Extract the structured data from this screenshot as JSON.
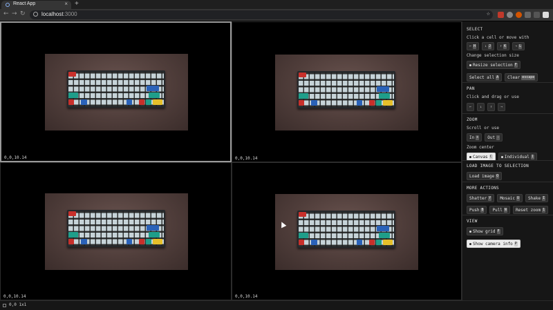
{
  "browser": {
    "tab_title": "React App",
    "tab_close": "×",
    "new_tab": "+",
    "back": "←",
    "forward": "→",
    "reload": "C",
    "url_host": "localhost",
    "url_port": ":3000",
    "star": "☆"
  },
  "grid": {
    "cells": [
      {
        "label": "0,0,10.14"
      },
      {
        "label": "0,0,10.14"
      },
      {
        "label": "0,0,10.14"
      },
      {
        "label": "0,0,10.14"
      }
    ]
  },
  "sidebar": {
    "select": {
      "title": "SELECT",
      "move_text": "Click a cell or move with",
      "move_keys": [
        {
          "icon": "←",
          "key": "H"
        },
        {
          "icon": "↓",
          "key": "J"
        },
        {
          "icon": "↑",
          "key": "K"
        },
        {
          "icon": "→",
          "key": "L"
        }
      ],
      "resize_text": "Change selection size",
      "resize_label": "Resize selection",
      "resize_key": "F",
      "select_all_label": "Select all",
      "select_all_key": "A",
      "clear_label": "Clear",
      "clear_key": "escape"
    },
    "pan": {
      "title": "PAN",
      "text": "Click and drag or use",
      "keys": [
        "←",
        "↓",
        "↑",
        "→"
      ]
    },
    "zoom": {
      "title": "ZOOM",
      "text": "Scroll or use",
      "in_label": "In",
      "in_key": "+",
      "out_label": "Out",
      "out_key": "-",
      "center_text": "Zoom center",
      "canvas_label": "Canvas",
      "canvas_key": "C",
      "individual_label": "Individual",
      "individual_key": "I"
    },
    "load": {
      "title": "LOAD IMAGE TO SELECTION",
      "button_label": "Load image",
      "button_key": "O"
    },
    "more": {
      "title": "MORE ACTIONS",
      "shatter_label": "Shatter",
      "shatter_key": "Y",
      "mosaic_label": "Mosaic",
      "mosaic_key": "U",
      "shake_label": "Shake",
      "shake_key": "I",
      "push_label": "Push",
      "push_key": "B",
      "pull_label": "Pull",
      "pull_key": "N",
      "reset_zoom_label": "Reset zoom",
      "reset_zoom_key": "1"
    },
    "view": {
      "title": "VIEW",
      "show_grid_label": "Show grid",
      "show_grid_key": "F",
      "show_camera_label": "Show camera info",
      "show_camera_key": "P"
    }
  },
  "status": {
    "text": "0,0 1x1"
  },
  "colors": {
    "accent_red": "#c8302b",
    "accent_teal": "#1f9e8a",
    "accent_blue": "#2a62b8",
    "accent_yellow": "#e6c02a"
  }
}
